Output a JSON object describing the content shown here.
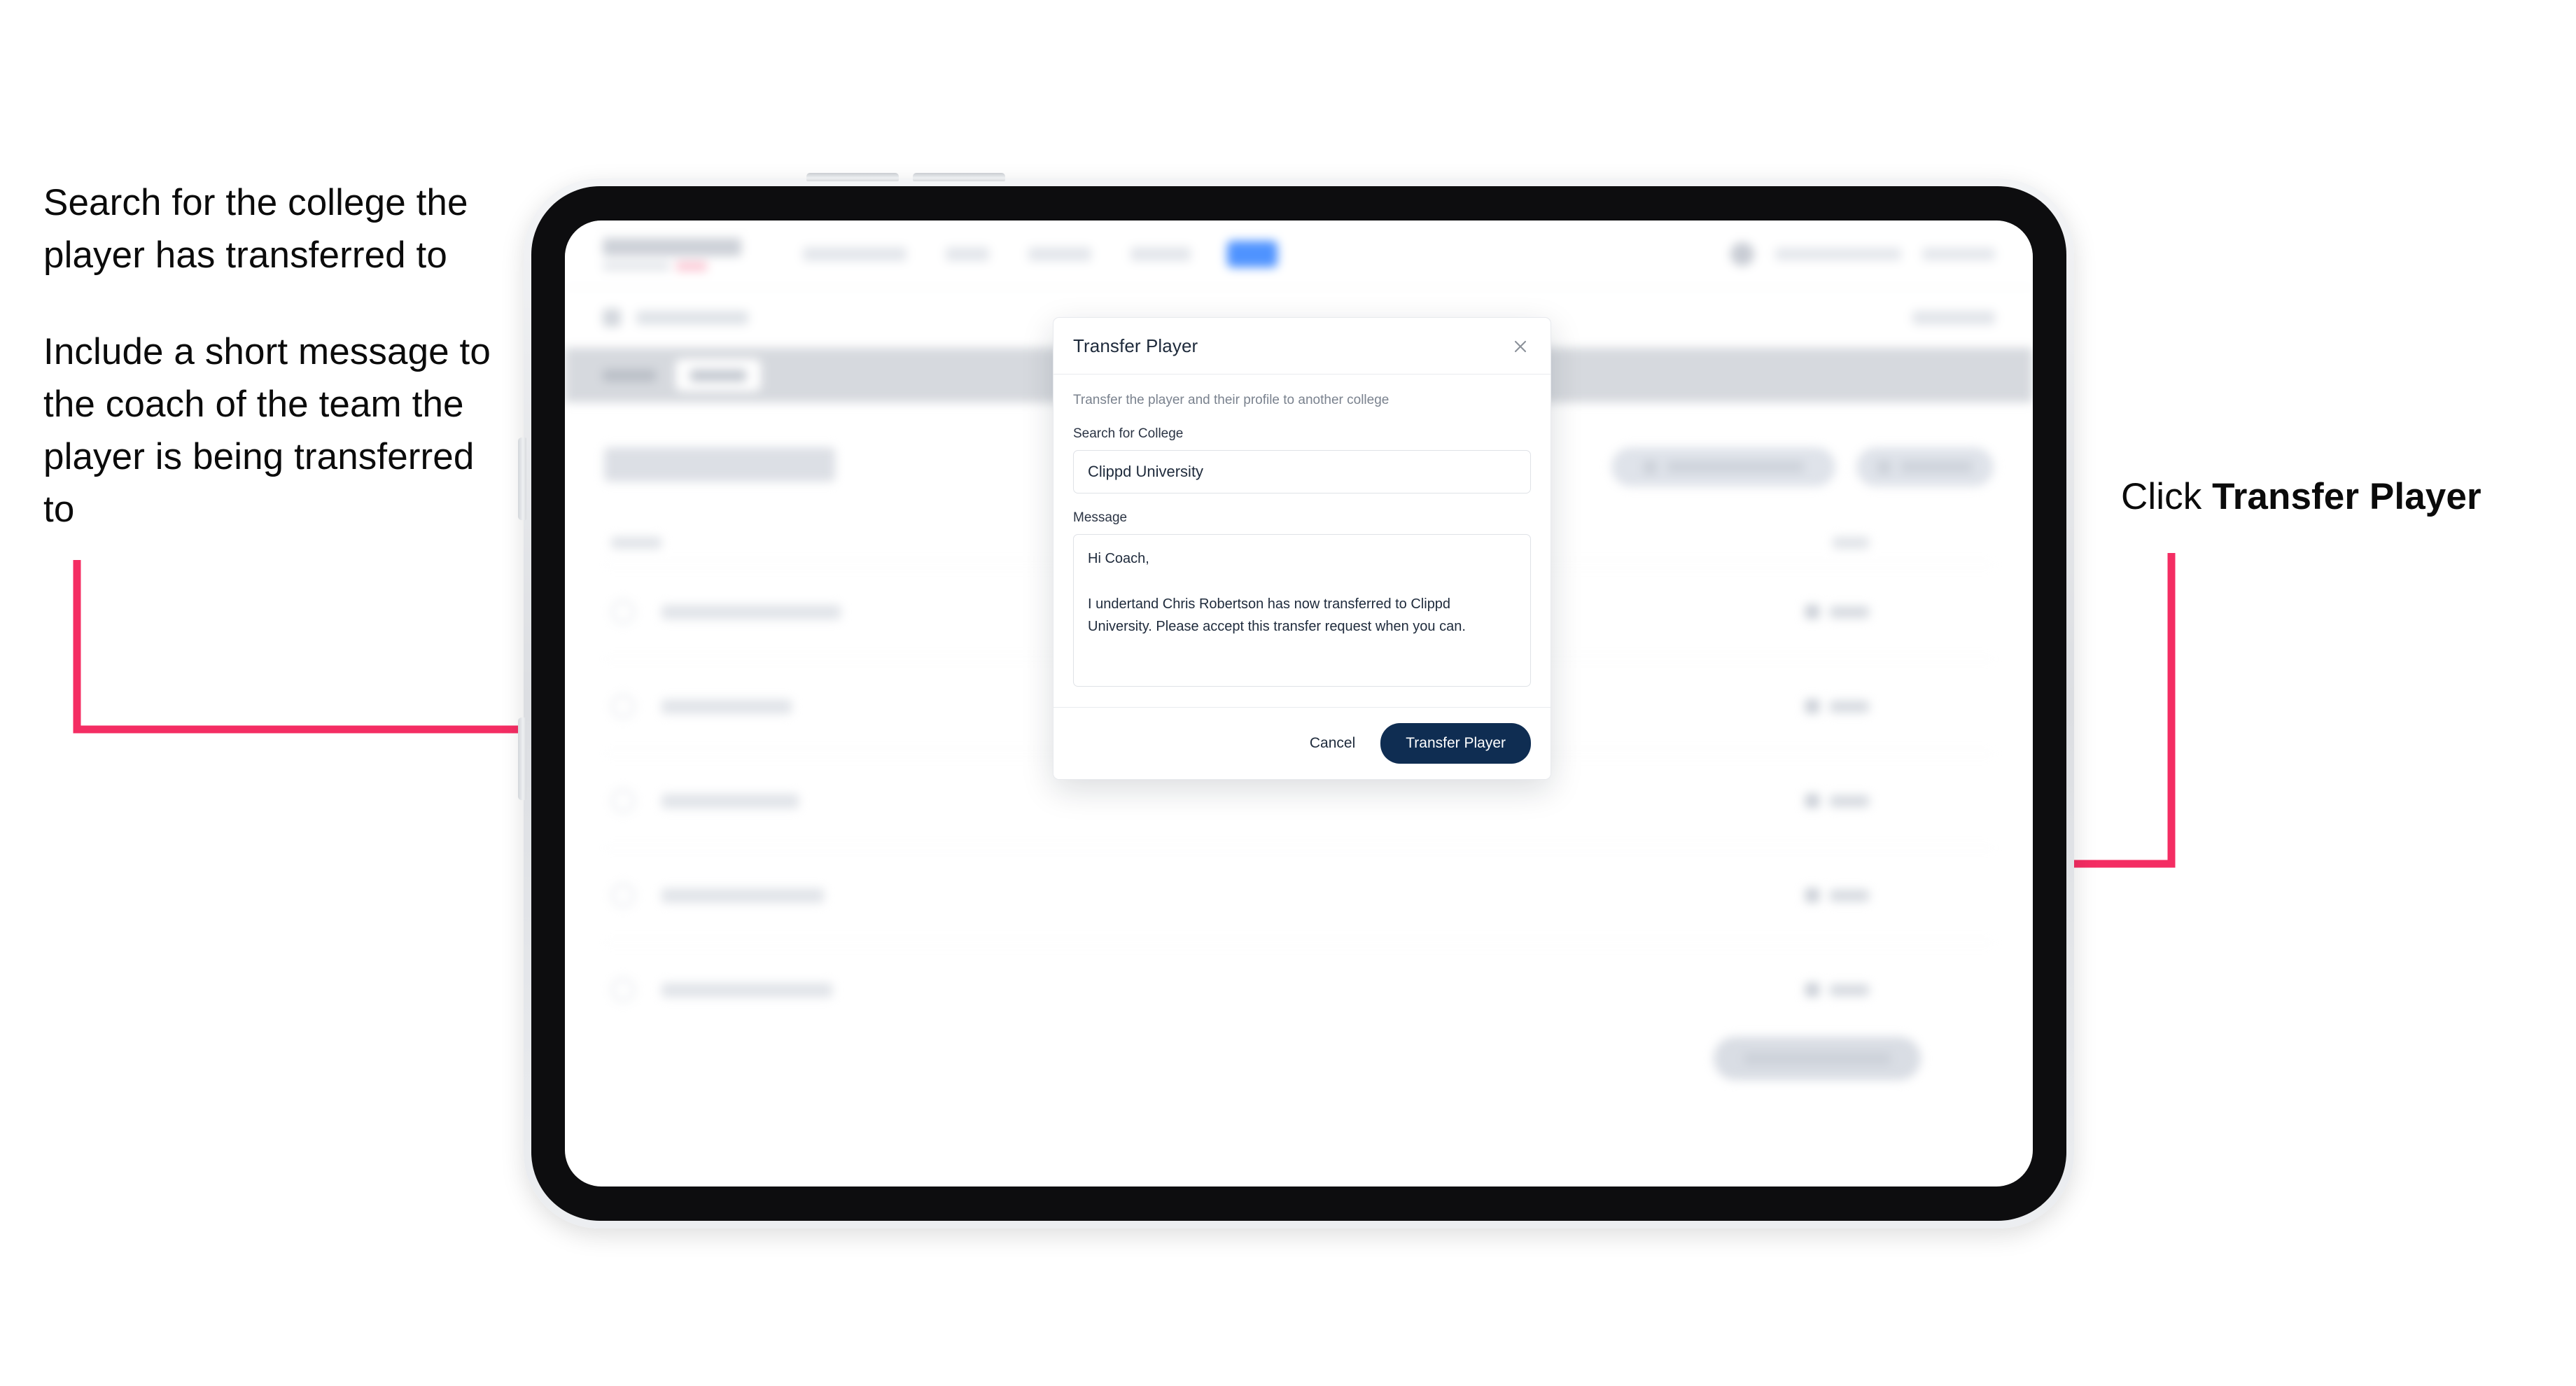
{
  "annotations": {
    "left": [
      "Search for the college the player has transferred to",
      "Include a short message to the coach of the team the player is being transferred to"
    ],
    "right": {
      "prefix": "Click ",
      "emphasis": "Transfer Player"
    }
  },
  "colors": {
    "arrow_pink": "#F42D63",
    "primary_navy": "#0F2D52",
    "subtab_bar": "#D6D9DE",
    "nav_pill_blue": "#4F93FF"
  },
  "modal": {
    "title": "Transfer Player",
    "close_icon": "close-icon",
    "subtitle": "Transfer the player and their profile to another college",
    "college": {
      "label": "Search for College",
      "value": "Clippd University",
      "placeholder": "Search for College"
    },
    "message": {
      "label": "Message",
      "value": "Hi Coach,\n\nI undertand Chris Robertson has now transferred to Clippd University. Please accept this transfer request when you can.",
      "placeholder": "Message"
    },
    "cancel_label": "Cancel",
    "submit_label": "Transfer Player"
  },
  "app": {
    "page_title": "Update Roster",
    "nav": {
      "logo": "SCOREBOARD",
      "items": [
        "Tournaments",
        "Team",
        "Analysis",
        "Analytics"
      ],
      "account": {
        "avatar": "avatar",
        "email": "user@clippd.io",
        "sign_out": "Sign Out"
      }
    },
    "breadcrumb": {
      "icon": "grid-icon",
      "label": "Scoreboard",
      "action": "Cancel"
    },
    "subtabs": [
      {
        "label": "Details",
        "active": false
      },
      {
        "label": "Roster",
        "active": true
      }
    ],
    "actions": [
      {
        "icon": "download-icon",
        "label": "Request Player Transfer"
      },
      {
        "icon": "plus-icon",
        "label": "Add Player"
      }
    ],
    "list": {
      "columns": [
        "Player",
        "EDIT"
      ],
      "rows": [
        {
          "name": "Chris Robertson",
          "edit": "Edit"
        },
        {
          "name": "Jay Whitaker",
          "edit": "Edit"
        },
        {
          "name": "John Taylor",
          "edit": "Edit"
        },
        {
          "name": "Lewis Sheridan",
          "edit": "Edit"
        },
        {
          "name": "Nathan Holmes",
          "edit": "Edit"
        }
      ]
    },
    "footer_button": "Save Roster Updates"
  }
}
